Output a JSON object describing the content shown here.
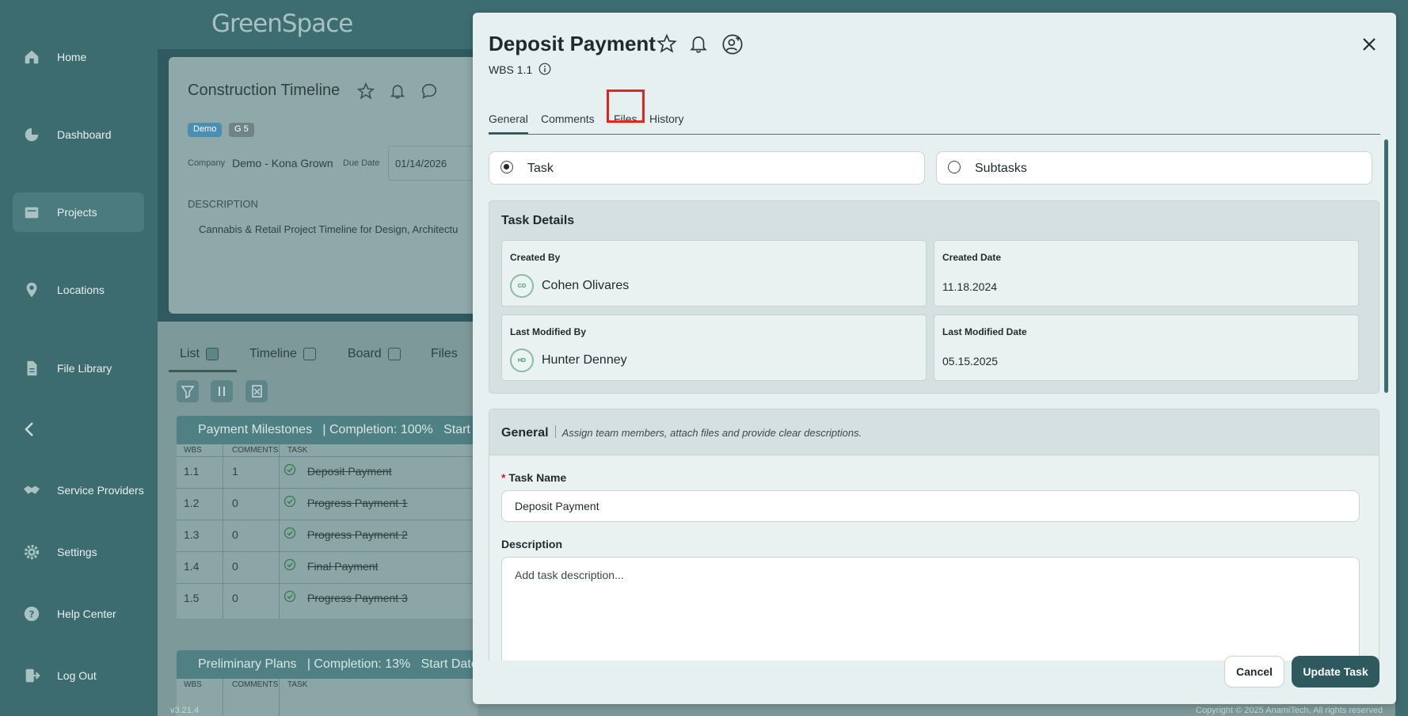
{
  "app": {
    "logo": "GreenSpace",
    "version": "v3.21.4",
    "copyright": "Copyright © 2025 AnamiTech, All rights reserved"
  },
  "sidebar": {
    "items": [
      {
        "label": "Home",
        "icon": "home-icon"
      },
      {
        "label": "Dashboard",
        "icon": "pie-chart-icon"
      },
      {
        "label": "Projects",
        "icon": "folder-icon"
      },
      {
        "label": "Locations",
        "icon": "map-pin-icon"
      },
      {
        "label": "File Library",
        "icon": "document-icon"
      },
      {
        "label": "Service Providers",
        "icon": "handshake-icon"
      },
      {
        "label": "Settings",
        "icon": "gear-icon"
      },
      {
        "label": "Help Center",
        "icon": "help-icon"
      },
      {
        "label": "Log Out",
        "icon": "logout-icon"
      }
    ]
  },
  "project": {
    "title": "Construction Timeline",
    "badges": [
      "Demo",
      "G 5"
    ],
    "company_label": "Company",
    "company": "Demo - Kona Grown",
    "due_label": "Due Date",
    "due_date": "01/14/2026",
    "description_label": "DESCRIPTION",
    "description": "Cannabis & Retail Project Timeline for Design, Architectu",
    "view_tabs": [
      "List",
      "Timeline",
      "Board",
      "Files"
    ],
    "table_headers": [
      "WBS",
      "COMMENTS",
      "TASK"
    ],
    "sections": [
      {
        "title": "Payment Milestones   | Completion: 100%   Start D",
        "rows": [
          {
            "wbs": "1.1",
            "comments": "1",
            "task": "Deposit Payment"
          },
          {
            "wbs": "1.2",
            "comments": "0",
            "task": "Progress Payment 1"
          },
          {
            "wbs": "1.3",
            "comments": "0",
            "task": "Progress Payment 2"
          },
          {
            "wbs": "1.4",
            "comments": "0",
            "task": "Final Payment"
          },
          {
            "wbs": "1.5",
            "comments": "0",
            "task": "Progress Payment 3"
          }
        ]
      },
      {
        "title": "Preliminary Plans   | Completion: 13%   Start Date:"
      }
    ]
  },
  "modal": {
    "title": "Deposit Payment",
    "wbs": "WBS 1.1",
    "tabs": [
      "General",
      "Comments",
      "Files",
      "History"
    ],
    "active_tab": "General",
    "highlighted_tab": "Files",
    "highlight_color": "#e3261b",
    "type_options": [
      "Task",
      "Subtasks"
    ],
    "selected_type": "Task",
    "task_details": {
      "heading": "Task Details",
      "created_by_label": "Created By",
      "created_by": "Cohen Olivares",
      "created_by_initials": "CO",
      "created_date_label": "Created Date",
      "created_date": "11.18.2024",
      "modified_by_label": "Last Modified By",
      "modified_by": "Hunter Denney",
      "modified_by_initials": "HD",
      "modified_date_label": "Last Modified Date",
      "modified_date": "05.15.2025"
    },
    "general": {
      "heading": "General",
      "subheading": "Assign team members, attach files and provide clear descriptions.",
      "task_name_label": "Task Name",
      "task_name_required": "*",
      "task_name": "Deposit Payment",
      "description_label": "Description",
      "description_placeholder": "Add task description..."
    },
    "buttons": {
      "cancel": "Cancel",
      "update": "Update Task"
    }
  },
  "colors": {
    "primary": "#2e5a5f",
    "sidebar": "#3d6c70",
    "modal_bg": "#e6f0f0"
  }
}
